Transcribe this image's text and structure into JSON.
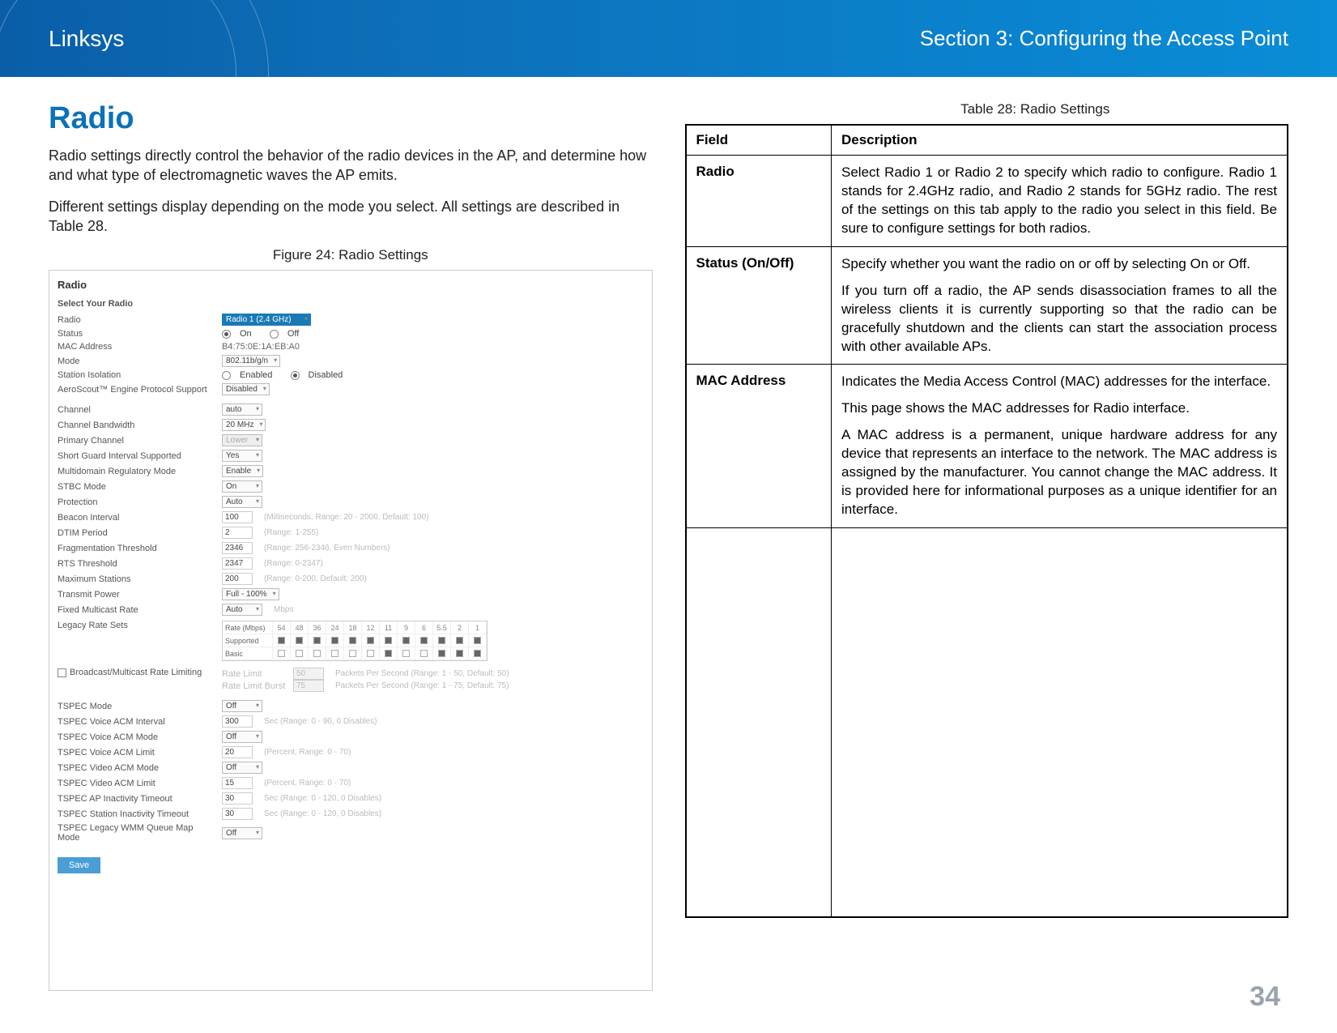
{
  "header": {
    "brand": "Linksys",
    "section": "Section 3:  Configuring the Access Point"
  },
  "h2": "Radio",
  "intro1": "Radio settings directly control the behavior of the radio devices in the AP, and determine how and what type of electromagnetic waves the AP emits.",
  "intro2": "Different settings display depending on the mode you select. All settings are described in Table 28.",
  "figure_caption": "Figure 24: Radio Settings",
  "table_caption": "Table 28: Radio Settings",
  "th_field": "Field",
  "th_desc": "Description",
  "rows": [
    {
      "field": "Radio",
      "paras": [
        "Select Radio 1 or Radio 2 to specify which radio to configure. Radio 1 stands for 2.4GHz radio, and Radio 2 stands for 5GHz radio. The rest of the settings on this tab apply to the radio you select in this field. Be sure to configure settings for both radios."
      ]
    },
    {
      "field": "Status (On/Off)",
      "paras": [
        "Specify whether you want the radio on or off by selecting On or Off.",
        "If you turn off a radio, the AP sends disassociation frames to all the wireless clients it is currently supporting so that the radio can be gracefully shutdown and the clients can start the association process with other available APs."
      ]
    },
    {
      "field": "MAC Address",
      "paras": [
        "Indicates the Media Access Control (MAC) addresses for the interface.",
        "This page shows the MAC addresses for Radio interface.",
        "A MAC address is a permanent, unique hardware address for any device that represents an interface to the network. The MAC address is assigned by the manufacturer. You cannot change the MAC address. It is provided here for informational purposes as a unique identifier for an interface."
      ]
    }
  ],
  "page_number": "34",
  "ss": {
    "heading": "Radio",
    "sub": "Select Your Radio",
    "radio_label": "Radio",
    "radio_val": "Radio 1 (2.4 GHz)",
    "status_label": "Status",
    "on": "On",
    "off": "Off",
    "mac_label": "MAC Address",
    "mac_val": "B4:75:0E:1A:EB:A0",
    "mode_label": "Mode",
    "mode_val": "802.11b/g/n",
    "isol_label": "Station Isolation",
    "enabled": "Enabled",
    "disabled": "Disabled",
    "aero_label": "AeroScout™ Engine Protocol Support",
    "aero_val": "Disabled",
    "channel_label": "Channel",
    "channel_val": "auto",
    "bw_label": "Channel Bandwidth",
    "bw_val": "20 MHz",
    "pchan_label": "Primary Channel",
    "pchan_val": "Lower",
    "sgi_label": "Short Guard Interval Supported",
    "sgi_val": "Yes",
    "mdreg_label": "Multidomain Regulatory Mode",
    "mdreg_val": "Enable",
    "stbc_label": "STBC Mode",
    "stbc_val": "On",
    "prot_label": "Protection",
    "prot_val": "Auto",
    "beacon_label": "Beacon Interval",
    "beacon_val": "100",
    "beacon_hint": "(Milliseconds, Range: 20 - 2000, Default: 100)",
    "dtim_label": "DTIM Period",
    "dtim_val": "2",
    "dtim_hint": "(Range: 1-255)",
    "frag_label": "Fragmentation Threshold",
    "frag_val": "2346",
    "frag_hint": "(Range: 256-2346, Even Numbers)",
    "rts_label": "RTS Threshold",
    "rts_val": "2347",
    "rts_hint": "(Range: 0-2347)",
    "max_label": "Maximum Stations",
    "max_val": "200",
    "max_hint": "(Range: 0-200, Default: 200)",
    "tx_label": "Transmit Power",
    "tx_val": "Full - 100%",
    "fmr_label": "Fixed Multicast Rate",
    "fmr_val": "Auto",
    "fmr_hint": "Mbps",
    "legacy_label": "Legacy Rate Sets",
    "rate_head": "Rate (Mbps)",
    "supported": "Supported",
    "basic": "Basic",
    "rates": [
      "54",
      "48",
      "36",
      "24",
      "18",
      "12",
      "11",
      "9",
      "6",
      "5.5",
      "2",
      "1"
    ],
    "bml_label": "Broadcast/Multicast Rate Limiting",
    "rl_label": "Rate Limit",
    "rl_val": "50",
    "rl_hint": "Packets Per Second (Range: 1 - 50, Default: 50)",
    "rlb_label": "Rate Limit Burst",
    "rlb_val": "75",
    "rlb_hint": "Packets Per Second (Range: 1 - 75, Default: 75)",
    "tspec_label": "TSPEC Mode",
    "tspec_val": "Off",
    "tvoi_label": "TSPEC Voice ACM Interval",
    "tvoi_val": "300",
    "tvoi_hint": "Sec (Range: 0 - 90, 0 Disables)",
    "tvoa_label": "TSPEC Voice ACM Mode",
    "tvoa_val": "Off",
    "tvoal_label": "TSPEC Voice ACM Limit",
    "tvoal_val": "20",
    "tvoal_hint": "(Percent, Range: 0 - 70)",
    "tvia_label": "TSPEC Video ACM Mode",
    "tvia_val": "Off",
    "tvial_label": "TSPEC Video ACM Limit",
    "tvial_val": "15",
    "tvial_hint": "(Percent, Range: 0 - 70)",
    "tapi_label": "TSPEC AP Inactivity Timeout",
    "tapi_val": "30",
    "tapi_hint": "Sec (Range: 0 - 120, 0 Disables)",
    "tsti_label": "TSPEC Station Inactivity Timeout",
    "tsti_val": "30",
    "tsti_hint": "Sec (Range: 0 - 120, 0 Disables)",
    "tleg_label": "TSPEC Legacy WMM Queue Map Mode",
    "tleg_val": "Off",
    "save": "Save"
  }
}
